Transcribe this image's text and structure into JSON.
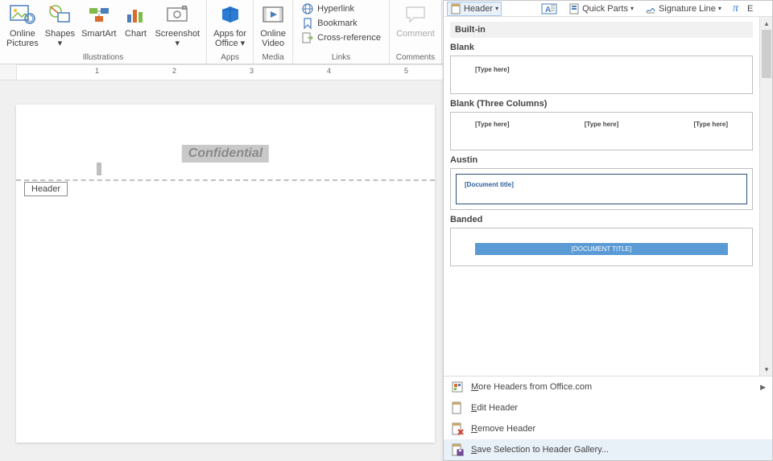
{
  "ribbon": {
    "groups": {
      "illustrations": {
        "label": "Illustrations",
        "online_pictures": "Online\nPictures",
        "shapes": "Shapes",
        "smartart": "SmartArt",
        "chart": "Chart",
        "screenshot": "Screenshot"
      },
      "apps": {
        "label": "Apps",
        "apps_for_office": "Apps for\nOffice"
      },
      "media": {
        "label": "Media",
        "online_video": "Online\nVideo"
      },
      "links": {
        "label": "Links",
        "hyperlink": "Hyperlink",
        "bookmark": "Bookmark",
        "cross_reference": "Cross-reference"
      },
      "comments": {
        "label": "Comments",
        "comment": "Comment"
      }
    }
  },
  "top_strip": {
    "header": "Header",
    "quick_parts": "Quick Parts",
    "signature_line": "Signature Line",
    "equation_glyph": "π",
    "equation_letter": "E"
  },
  "ruler": {
    "marks": [
      "1",
      "2",
      "3",
      "4"
    ]
  },
  "document": {
    "watermark": "Confidential",
    "header_tag": "Header"
  },
  "gallery": {
    "section": "Built-in",
    "items": [
      {
        "name": "Blank",
        "placeholder": "[Type here]"
      },
      {
        "name": "Blank (Three Columns)",
        "placeholder": "[Type here]"
      },
      {
        "name": "Austin",
        "placeholder": "[Document title]"
      },
      {
        "name": "Banded",
        "placeholder": "[DOCUMENT TITLE]"
      }
    ],
    "footer": {
      "more": "More Headers from Office.com",
      "edit": "Edit Header",
      "remove": "Remove Header",
      "save": "Save Selection to Header Gallery..."
    }
  }
}
